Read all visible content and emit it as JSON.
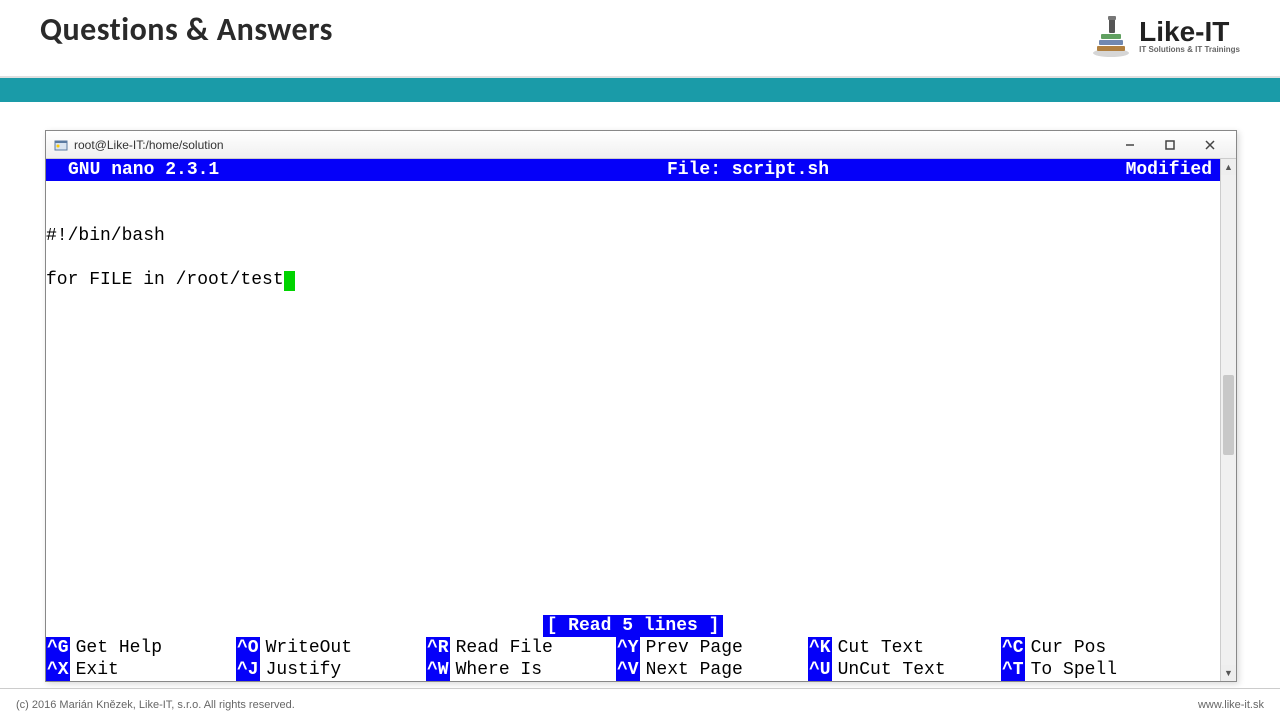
{
  "slide": {
    "title": "Questions & Answers",
    "copyright": "(c) 2016 Marián Knězek, Like-IT, s.r.o. All rights reserved.",
    "website": "www.like-it.sk"
  },
  "logo": {
    "main": "Like-IT",
    "sub": "IT Solutions & IT Trainings"
  },
  "window": {
    "title": "root@Like-IT:/home/solution"
  },
  "nano": {
    "app": "  GNU nano 2.3.1",
    "file_label": "File: script.sh",
    "status_right": "Modified",
    "status_msg": "[ Read 5 lines ]",
    "code": {
      "line1": "#!/bin/bash",
      "line2": "",
      "line3": "for FILE in /root/test"
    },
    "shortcuts": {
      "row1": [
        {
          "key": "^G",
          "label": "Get Help"
        },
        {
          "key": "^O",
          "label": "WriteOut"
        },
        {
          "key": "^R",
          "label": "Read File"
        },
        {
          "key": "^Y",
          "label": "Prev Page"
        },
        {
          "key": "^K",
          "label": "Cut Text"
        },
        {
          "key": "^C",
          "label": "Cur Pos"
        }
      ],
      "row2": [
        {
          "key": "^X",
          "label": "Exit"
        },
        {
          "key": "^J",
          "label": "Justify"
        },
        {
          "key": "^W",
          "label": "Where Is"
        },
        {
          "key": "^V",
          "label": "Next Page"
        },
        {
          "key": "^U",
          "label": "UnCut Text"
        },
        {
          "key": "^T",
          "label": "To Spell"
        }
      ]
    }
  }
}
